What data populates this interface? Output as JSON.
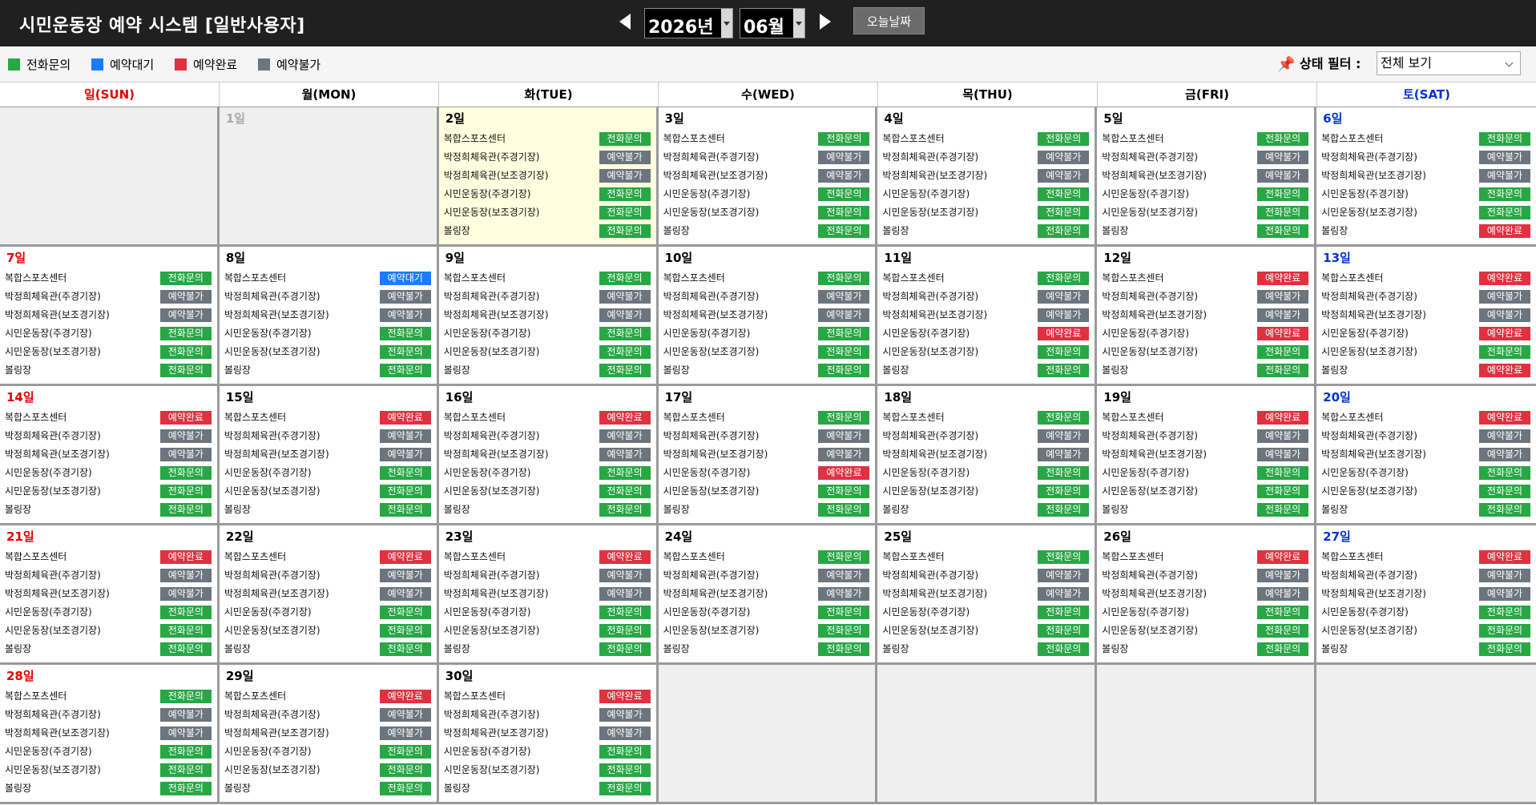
{
  "header": {
    "title": "시민운동장 예약 시스템 [일반사용자]",
    "year": "2026년",
    "month": "06월",
    "today_button": "오늘날짜",
    "prev_icon": "triangle-left-icon",
    "next_icon": "triangle-right-icon"
  },
  "legend": [
    {
      "label": "전화문의",
      "color": "#28a745"
    },
    {
      "label": "예약대기",
      "color": "#1a7cff"
    },
    {
      "label": "예약완료",
      "color": "#e03140"
    },
    {
      "label": "예약불가",
      "color": "#6c757d"
    }
  ],
  "filter": {
    "icon": "pin-icon",
    "label": "상태 필터 :",
    "selected": "전체 보기"
  },
  "weekdays": [
    {
      "label": "일(SUN)",
      "color": "#e60000"
    },
    {
      "label": "월(MON)",
      "color": "#000000"
    },
    {
      "label": "화(TUE)",
      "color": "#000000"
    },
    {
      "label": "수(WED)",
      "color": "#000000"
    },
    {
      "label": "목(THU)",
      "color": "#000000"
    },
    {
      "label": "금(FRI)",
      "color": "#000000"
    },
    {
      "label": "토(SAT)",
      "color": "#0033cc"
    }
  ],
  "facilities": [
    "복합스포츠센터",
    "박정희체육관(주경기장)",
    "박정희체육관(보조경기장)",
    "시민운동장(주경기장)",
    "시민운동장(보조경기장)",
    "볼링장"
  ],
  "status_colors": {
    "전화문의": "#28a745",
    "예약대기": "#1a7cff",
    "예약완료": "#e03140",
    "예약불가": "#6c757d"
  },
  "calendar": {
    "leading_blank": 1,
    "inactive_days": [
      {
        "label": "1일"
      }
    ],
    "trailing_blank": 4,
    "today_label": "2일",
    "days": [
      {
        "label": "2일",
        "statuses": [
          "전화문의",
          "예약불가",
          "예약불가",
          "전화문의",
          "전화문의",
          "전화문의"
        ]
      },
      {
        "label": "3일",
        "statuses": [
          "전화문의",
          "예약불가",
          "예약불가",
          "전화문의",
          "전화문의",
          "전화문의"
        ]
      },
      {
        "label": "4일",
        "statuses": [
          "전화문의",
          "예약불가",
          "예약불가",
          "전화문의",
          "전화문의",
          "전화문의"
        ]
      },
      {
        "label": "5일",
        "statuses": [
          "전화문의",
          "예약불가",
          "예약불가",
          "전화문의",
          "전화문의",
          "전화문의"
        ]
      },
      {
        "label": "6일",
        "statuses": [
          "전화문의",
          "예약불가",
          "예약불가",
          "전화문의",
          "전화문의",
          "예약완료"
        ]
      },
      {
        "label": "7일",
        "statuses": [
          "전화문의",
          "예약불가",
          "예약불가",
          "전화문의",
          "전화문의",
          "전화문의"
        ]
      },
      {
        "label": "8일",
        "statuses": [
          "예약대기",
          "예약불가",
          "예약불가",
          "전화문의",
          "전화문의",
          "전화문의"
        ]
      },
      {
        "label": "9일",
        "statuses": [
          "전화문의",
          "예약불가",
          "예약불가",
          "전화문의",
          "전화문의",
          "전화문의"
        ]
      },
      {
        "label": "10일",
        "statuses": [
          "전화문의",
          "예약불가",
          "예약불가",
          "전화문의",
          "전화문의",
          "전화문의"
        ]
      },
      {
        "label": "11일",
        "statuses": [
          "전화문의",
          "예약불가",
          "예약불가",
          "예약완료",
          "전화문의",
          "전화문의"
        ]
      },
      {
        "label": "12일",
        "statuses": [
          "예약완료",
          "예약불가",
          "예약불가",
          "예약완료",
          "전화문의",
          "전화문의"
        ]
      },
      {
        "label": "13일",
        "statuses": [
          "예약완료",
          "예약불가",
          "예약불가",
          "예약완료",
          "전화문의",
          "예약완료"
        ]
      },
      {
        "label": "14일",
        "statuses": [
          "예약완료",
          "예약불가",
          "예약불가",
          "전화문의",
          "전화문의",
          "전화문의"
        ]
      },
      {
        "label": "15일",
        "statuses": [
          "예약완료",
          "예약불가",
          "예약불가",
          "전화문의",
          "전화문의",
          "전화문의"
        ]
      },
      {
        "label": "16일",
        "statuses": [
          "예약완료",
          "예약불가",
          "예약불가",
          "전화문의",
          "전화문의",
          "전화문의"
        ]
      },
      {
        "label": "17일",
        "statuses": [
          "전화문의",
          "예약불가",
          "예약불가",
          "예약완료",
          "전화문의",
          "전화문의"
        ]
      },
      {
        "label": "18일",
        "statuses": [
          "전화문의",
          "예약불가",
          "예약불가",
          "전화문의",
          "전화문의",
          "전화문의"
        ]
      },
      {
        "label": "19일",
        "statuses": [
          "예약완료",
          "예약불가",
          "예약불가",
          "전화문의",
          "전화문의",
          "전화문의"
        ]
      },
      {
        "label": "20일",
        "statuses": [
          "예약완료",
          "예약불가",
          "예약불가",
          "전화문의",
          "전화문의",
          "전화문의"
        ]
      },
      {
        "label": "21일",
        "statuses": [
          "예약완료",
          "예약불가",
          "예약불가",
          "전화문의",
          "전화문의",
          "전화문의"
        ]
      },
      {
        "label": "22일",
        "statuses": [
          "예약완료",
          "예약불가",
          "예약불가",
          "전화문의",
          "전화문의",
          "전화문의"
        ]
      },
      {
        "label": "23일",
        "statuses": [
          "예약완료",
          "예약불가",
          "예약불가",
          "전화문의",
          "전화문의",
          "전화문의"
        ]
      },
      {
        "label": "24일",
        "statuses": [
          "전화문의",
          "예약불가",
          "예약불가",
          "전화문의",
          "전화문의",
          "전화문의"
        ]
      },
      {
        "label": "25일",
        "statuses": [
          "전화문의",
          "예약불가",
          "예약불가",
          "전화문의",
          "전화문의",
          "전화문의"
        ]
      },
      {
        "label": "26일",
        "statuses": [
          "예약완료",
          "예약불가",
          "예약불가",
          "전화문의",
          "전화문의",
          "전화문의"
        ]
      },
      {
        "label": "27일",
        "statuses": [
          "예약완료",
          "예약불가",
          "예약불가",
          "전화문의",
          "전화문의",
          "전화문의"
        ]
      },
      {
        "label": "28일",
        "statuses": [
          "전화문의",
          "예약불가",
          "예약불가",
          "전화문의",
          "전화문의",
          "전화문의"
        ]
      },
      {
        "label": "29일",
        "statuses": [
          "예약완료",
          "예약불가",
          "예약불가",
          "전화문의",
          "전화문의",
          "전화문의"
        ]
      },
      {
        "label": "30일",
        "statuses": [
          "예약완료",
          "예약불가",
          "예약불가",
          "전화문의",
          "전화문의",
          "전화문의"
        ]
      }
    ]
  }
}
